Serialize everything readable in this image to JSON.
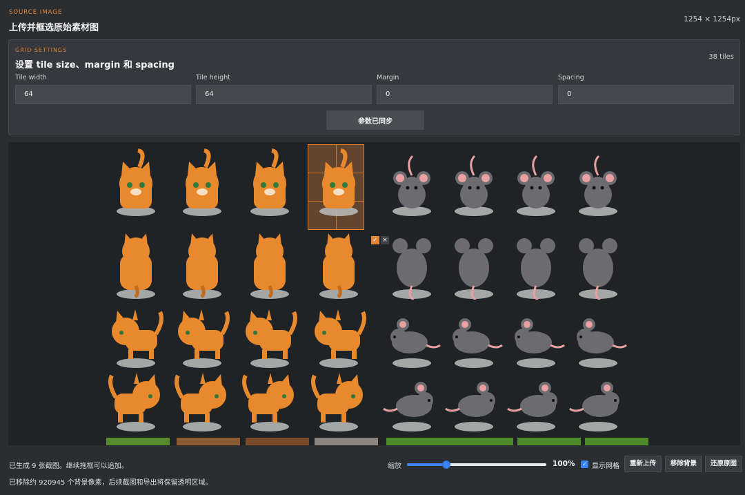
{
  "header": {
    "eyebrow": "SOURCE IMAGE",
    "title": "上传并框选原始素材图",
    "dimensions": "1254 × 1254px"
  },
  "grid_settings": {
    "eyebrow": "GRID SETTINGS",
    "title": "设置 tile size、margin 和 spacing",
    "tile_count": "38 tiles",
    "fields": [
      {
        "label": "Tile width",
        "value": "64"
      },
      {
        "label": "Tile height",
        "value": "64"
      },
      {
        "label": "Margin",
        "value": "0"
      },
      {
        "label": "Spacing",
        "value": "0"
      }
    ],
    "sync_button": "参数已同步"
  },
  "canvas": {
    "selection_confirm_icon": "check-icon",
    "selection_cancel_icon": "close-icon",
    "confirm_glyph": "✓",
    "cancel_glyph": "×"
  },
  "footer": {
    "status_line_1": "已生成 9 张截图。继续拖框可以追加。",
    "status_line_2": "已移除约 920945 个背景像素，后续截图和导出将保留透明区域。",
    "zoom_label": "缩放",
    "zoom_value": "100%",
    "zoom_fraction": 0.28,
    "show_grid_label": "显示网格",
    "show_grid_checked": true,
    "buttons": {
      "reupload": "重新上传",
      "remove_bg": "移除背景",
      "restore": "还原原图"
    }
  },
  "colors": {
    "accent": "#e0873a",
    "slider": "#3b82f6",
    "cat_orange": "#e8892e",
    "mouse_gray": "#6b6b70"
  }
}
